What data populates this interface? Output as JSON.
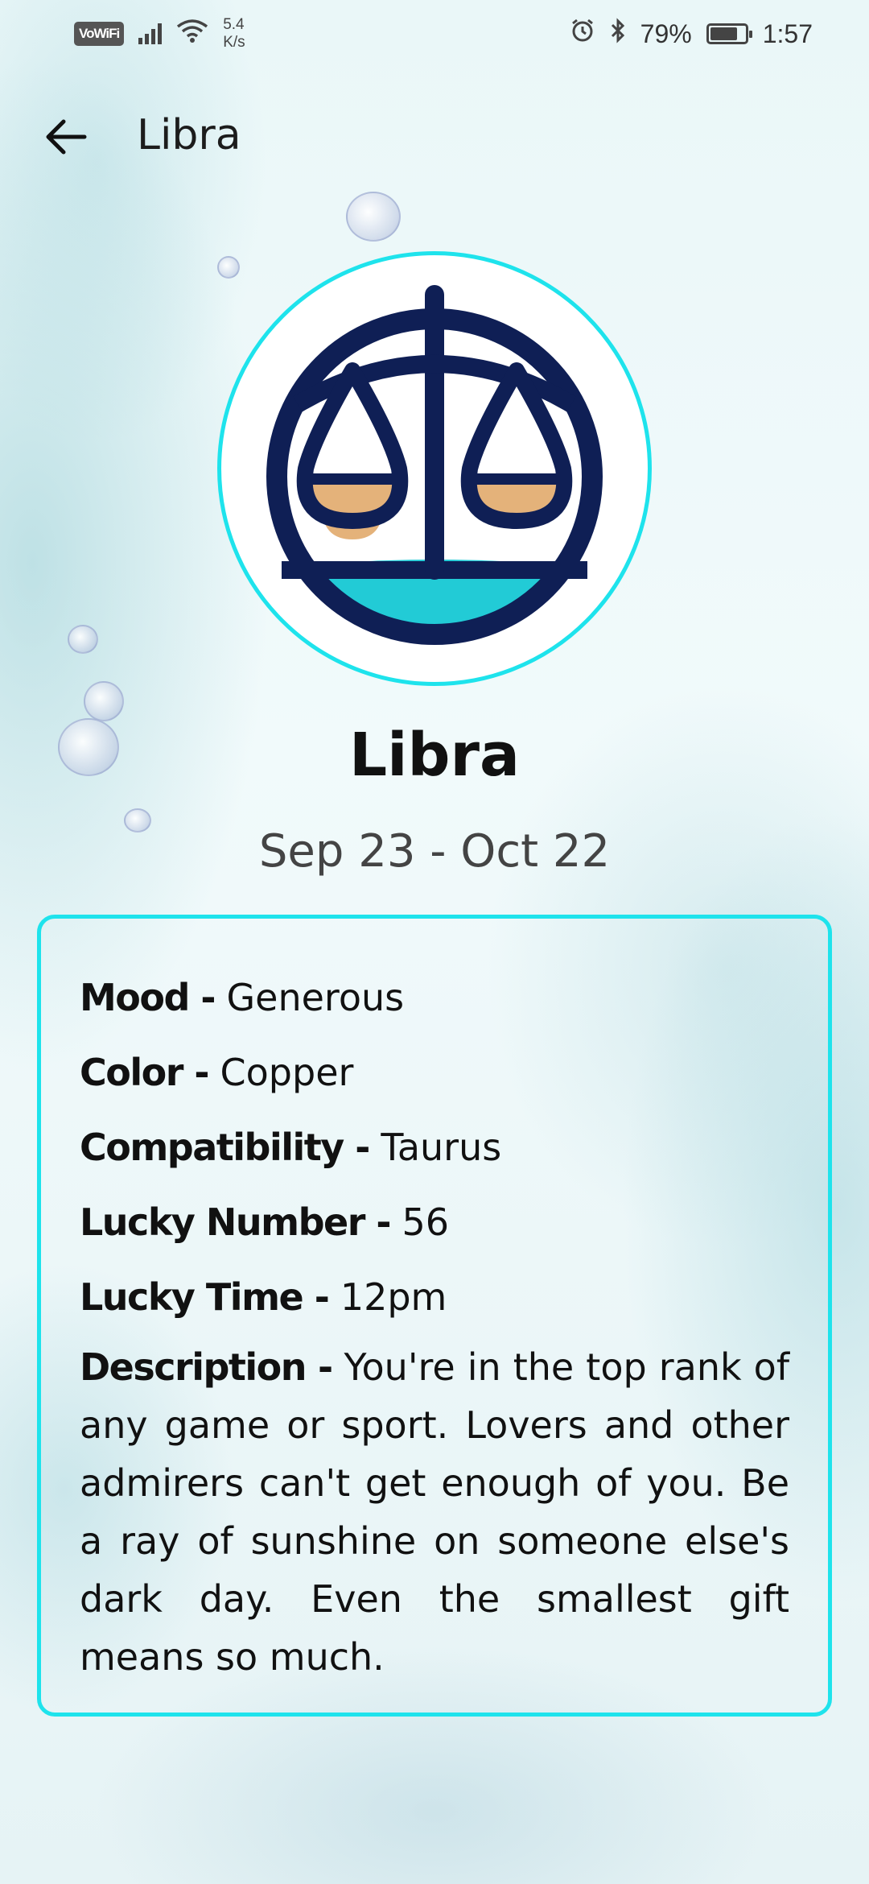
{
  "status_bar": {
    "wifi_label": "VoWiFi",
    "speed_value": "5.4",
    "speed_unit": "K/s",
    "battery_percent": "79%",
    "battery_level": 0.79,
    "time": "1:57"
  },
  "app_bar": {
    "title": "Libra",
    "back_icon": "arrow-left-icon"
  },
  "sign": {
    "icon": "libra-scales-icon",
    "name": "Libra",
    "dates": "Sep 23 - Oct 22",
    "colors": {
      "ring": "#1ee3ec",
      "navy": "#0f1f55",
      "gold": "#e4b27a",
      "teal": "#22cbd6"
    }
  },
  "details": {
    "mood_label": "Mood - ",
    "mood_value": "Generous",
    "color_label": "Color - ",
    "color_value": "Copper",
    "compatibility_label": "Compatibility - ",
    "compatibility_value": "Taurus",
    "lucky_number_label": "Lucky Number - ",
    "lucky_number_value": "56",
    "lucky_time_label": "Lucky Time - ",
    "lucky_time_value": "12pm",
    "description_label": "Description - ",
    "description_value": "You're in the top rank of any game or sport. Lovers and other admirers can't get enough of you. Be a ray of sunshine on someone else's dark day. Even the smallest gift means so much."
  }
}
